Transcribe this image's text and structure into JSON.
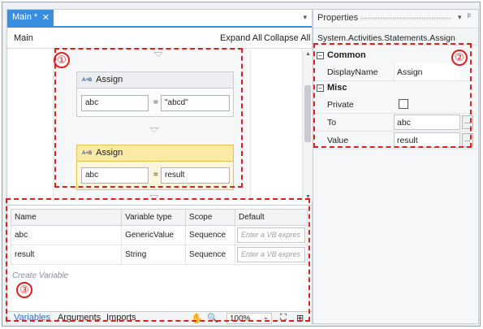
{
  "workflow": {
    "tab_label": "Main *",
    "tab_close": "✕",
    "tab_dropdown": "▾",
    "title": "Main",
    "expand_all": "Expand All",
    "collapse_all": "Collapse All",
    "activities": [
      {
        "title": "Assign",
        "to": "abc",
        "eq": "=",
        "value": "\"abcd\"",
        "selected": false
      },
      {
        "title": "Assign",
        "to": "abc",
        "eq": "=",
        "value": "result",
        "selected": true
      }
    ]
  },
  "variables": {
    "columns": [
      "Name",
      "Variable type",
      "Scope",
      "Default"
    ],
    "rows": [
      {
        "name": "abc",
        "type": "GenericValue",
        "scope": "Sequence",
        "default_placeholder": "Enter a VB expres"
      },
      {
        "name": "result",
        "type": "String",
        "scope": "Sequence",
        "default_placeholder": "Enter a VB expres"
      }
    ],
    "create_label": "Create Variable"
  },
  "bottom_bar": {
    "tabs": [
      "Variables",
      "Arguments",
      "Imports"
    ],
    "zoom": "100%",
    "hand_icon": "hand-pan-icon",
    "zoom_icon": "magnifier-icon",
    "fit_icon": "fit-to-screen-icon",
    "overview_icon": "overview-icon"
  },
  "properties": {
    "title": "Properties",
    "pin_dropdown": "▾",
    "pin": "ᵖ",
    "type": "System.Activities.Statements.Assign",
    "categories": [
      {
        "name": "Common",
        "toggle": "−",
        "rows": [
          {
            "name": "DisplayName",
            "value": "Assign",
            "kind": "text"
          }
        ]
      },
      {
        "name": "Misc",
        "toggle": "−",
        "rows": [
          {
            "name": "Private",
            "value": "",
            "kind": "checkbox"
          },
          {
            "name": "To",
            "value": "abc",
            "kind": "box"
          },
          {
            "name": "Value",
            "value": "result",
            "kind": "box"
          }
        ]
      }
    ]
  },
  "annotations": [
    "①",
    "②",
    "③"
  ],
  "colors": {
    "accent": "#3b8de0",
    "annotation": "#e02020",
    "selected": "#fbe9a6"
  }
}
